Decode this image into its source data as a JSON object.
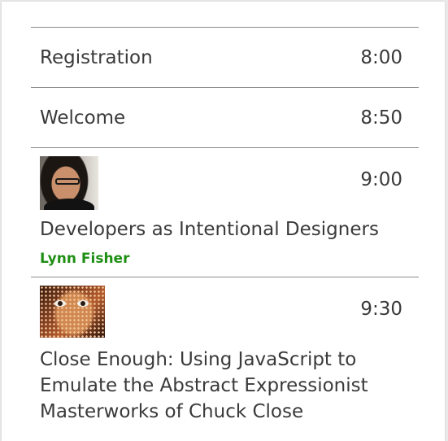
{
  "schedule": {
    "items": [
      {
        "title": "Registration",
        "time": "8:00"
      },
      {
        "title": "Welcome",
        "time": "8:50"
      },
      {
        "title": "Developers as Intentional Designers",
        "time": "9:00",
        "speaker": "Lynn Fisher",
        "speaker_color": "#1f8f14"
      },
      {
        "title": "Close Enough: Using JavaScript to Emulate the Abstract Expressionist Masterworks of Chuck Close",
        "time": "9:30"
      }
    ]
  }
}
